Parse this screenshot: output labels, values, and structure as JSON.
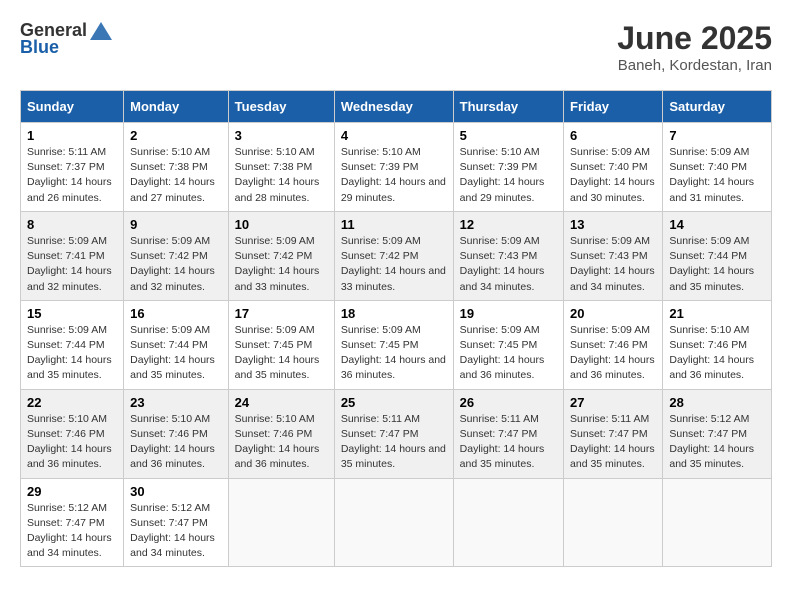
{
  "logo": {
    "general": "General",
    "blue": "Blue"
  },
  "title": "June 2025",
  "location": "Baneh, Kordestan, Iran",
  "weekdays": [
    "Sunday",
    "Monday",
    "Tuesday",
    "Wednesday",
    "Thursday",
    "Friday",
    "Saturday"
  ],
  "weeks": [
    [
      {
        "day": "1",
        "sunrise": "5:11 AM",
        "sunset": "7:37 PM",
        "daylight": "14 hours and 26 minutes."
      },
      {
        "day": "2",
        "sunrise": "5:10 AM",
        "sunset": "7:38 PM",
        "daylight": "14 hours and 27 minutes."
      },
      {
        "day": "3",
        "sunrise": "5:10 AM",
        "sunset": "7:38 PM",
        "daylight": "14 hours and 28 minutes."
      },
      {
        "day": "4",
        "sunrise": "5:10 AM",
        "sunset": "7:39 PM",
        "daylight": "14 hours and 29 minutes."
      },
      {
        "day": "5",
        "sunrise": "5:10 AM",
        "sunset": "7:39 PM",
        "daylight": "14 hours and 29 minutes."
      },
      {
        "day": "6",
        "sunrise": "5:09 AM",
        "sunset": "7:40 PM",
        "daylight": "14 hours and 30 minutes."
      },
      {
        "day": "7",
        "sunrise": "5:09 AM",
        "sunset": "7:40 PM",
        "daylight": "14 hours and 31 minutes."
      }
    ],
    [
      {
        "day": "8",
        "sunrise": "5:09 AM",
        "sunset": "7:41 PM",
        "daylight": "14 hours and 32 minutes."
      },
      {
        "day": "9",
        "sunrise": "5:09 AM",
        "sunset": "7:42 PM",
        "daylight": "14 hours and 32 minutes."
      },
      {
        "day": "10",
        "sunrise": "5:09 AM",
        "sunset": "7:42 PM",
        "daylight": "14 hours and 33 minutes."
      },
      {
        "day": "11",
        "sunrise": "5:09 AM",
        "sunset": "7:42 PM",
        "daylight": "14 hours and 33 minutes."
      },
      {
        "day": "12",
        "sunrise": "5:09 AM",
        "sunset": "7:43 PM",
        "daylight": "14 hours and 34 minutes."
      },
      {
        "day": "13",
        "sunrise": "5:09 AM",
        "sunset": "7:43 PM",
        "daylight": "14 hours and 34 minutes."
      },
      {
        "day": "14",
        "sunrise": "5:09 AM",
        "sunset": "7:44 PM",
        "daylight": "14 hours and 35 minutes."
      }
    ],
    [
      {
        "day": "15",
        "sunrise": "5:09 AM",
        "sunset": "7:44 PM",
        "daylight": "14 hours and 35 minutes."
      },
      {
        "day": "16",
        "sunrise": "5:09 AM",
        "sunset": "7:44 PM",
        "daylight": "14 hours and 35 minutes."
      },
      {
        "day": "17",
        "sunrise": "5:09 AM",
        "sunset": "7:45 PM",
        "daylight": "14 hours and 35 minutes."
      },
      {
        "day": "18",
        "sunrise": "5:09 AM",
        "sunset": "7:45 PM",
        "daylight": "14 hours and 36 minutes."
      },
      {
        "day": "19",
        "sunrise": "5:09 AM",
        "sunset": "7:45 PM",
        "daylight": "14 hours and 36 minutes."
      },
      {
        "day": "20",
        "sunrise": "5:09 AM",
        "sunset": "7:46 PM",
        "daylight": "14 hours and 36 minutes."
      },
      {
        "day": "21",
        "sunrise": "5:10 AM",
        "sunset": "7:46 PM",
        "daylight": "14 hours and 36 minutes."
      }
    ],
    [
      {
        "day": "22",
        "sunrise": "5:10 AM",
        "sunset": "7:46 PM",
        "daylight": "14 hours and 36 minutes."
      },
      {
        "day": "23",
        "sunrise": "5:10 AM",
        "sunset": "7:46 PM",
        "daylight": "14 hours and 36 minutes."
      },
      {
        "day": "24",
        "sunrise": "5:10 AM",
        "sunset": "7:46 PM",
        "daylight": "14 hours and 36 minutes."
      },
      {
        "day": "25",
        "sunrise": "5:11 AM",
        "sunset": "7:47 PM",
        "daylight": "14 hours and 35 minutes."
      },
      {
        "day": "26",
        "sunrise": "5:11 AM",
        "sunset": "7:47 PM",
        "daylight": "14 hours and 35 minutes."
      },
      {
        "day": "27",
        "sunrise": "5:11 AM",
        "sunset": "7:47 PM",
        "daylight": "14 hours and 35 minutes."
      },
      {
        "day": "28",
        "sunrise": "5:12 AM",
        "sunset": "7:47 PM",
        "daylight": "14 hours and 35 minutes."
      }
    ],
    [
      {
        "day": "29",
        "sunrise": "5:12 AM",
        "sunset": "7:47 PM",
        "daylight": "14 hours and 34 minutes."
      },
      {
        "day": "30",
        "sunrise": "5:12 AM",
        "sunset": "7:47 PM",
        "daylight": "14 hours and 34 minutes."
      },
      null,
      null,
      null,
      null,
      null
    ]
  ]
}
